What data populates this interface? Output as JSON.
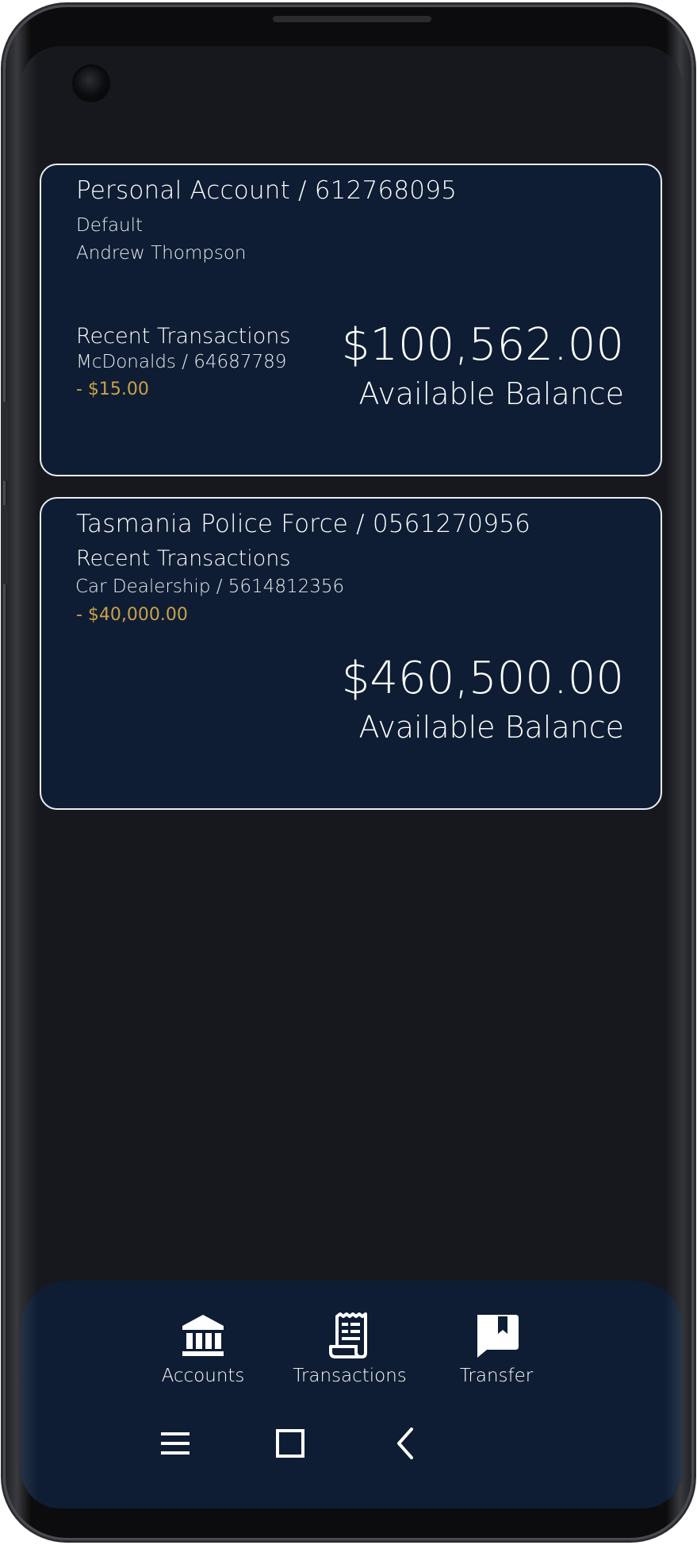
{
  "accounts": [
    {
      "title": "Personal Account / 612768095",
      "tag": "Default",
      "holder": "Andrew Thompson",
      "recent_label": "Recent Transactions",
      "recent_merchant": "McDonalds / 64687789",
      "recent_amount": "- $15.00",
      "balance": "$100,562.00",
      "balance_label": "Available Balance"
    },
    {
      "title": "Tasmania Police Force / 0561270956",
      "recent_label": "Recent Transactions",
      "recent_merchant": "Car Dealership / 5614812356",
      "recent_amount": "- $40,000.00",
      "balance": "$460,500.00",
      "balance_label": "Available Balance"
    }
  ],
  "bottom_nav": [
    {
      "label": "Accounts",
      "icon": "bank-icon"
    },
    {
      "label": "Transactions",
      "icon": "receipt-icon"
    },
    {
      "label": "Transfer",
      "icon": "bookmark-chat-icon"
    }
  ],
  "system_nav": [
    {
      "icon": "recent-apps-icon"
    },
    {
      "icon": "home-icon"
    },
    {
      "icon": "back-icon"
    }
  ],
  "colors": {
    "background": "#16181d",
    "card": "#0e1d33",
    "card_border": "#e9edf2",
    "debit": "#c9a14a",
    "text": "#ffffff"
  }
}
